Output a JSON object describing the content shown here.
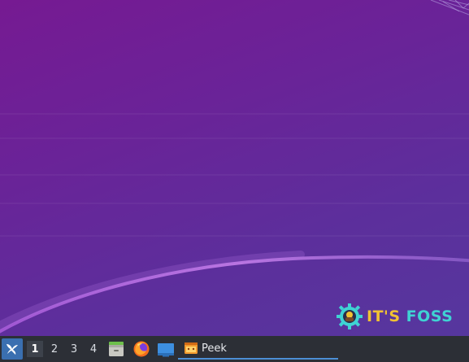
{
  "watermark": {
    "its": "IT'S",
    "foss": "FOSS",
    "color_primary": "#3fd3d3",
    "color_accent": "#f1c232"
  },
  "taskbar": {
    "menu_icon": "lxqt-menu-icon",
    "workspaces": [
      {
        "label": "1",
        "active": true
      },
      {
        "label": "2",
        "active": false
      },
      {
        "label": "3",
        "active": false
      },
      {
        "label": "4",
        "active": false
      }
    ],
    "launchers": [
      {
        "icon": "file-manager-icon"
      },
      {
        "icon": "firefox-icon"
      },
      {
        "icon": "show-desktop-icon"
      }
    ],
    "tasks": [
      {
        "label": "Peek",
        "icon": "peek-app-icon",
        "active": true
      }
    ],
    "colors": {
      "background": "#2c2f36",
      "accent": "#4c8fd6"
    }
  }
}
